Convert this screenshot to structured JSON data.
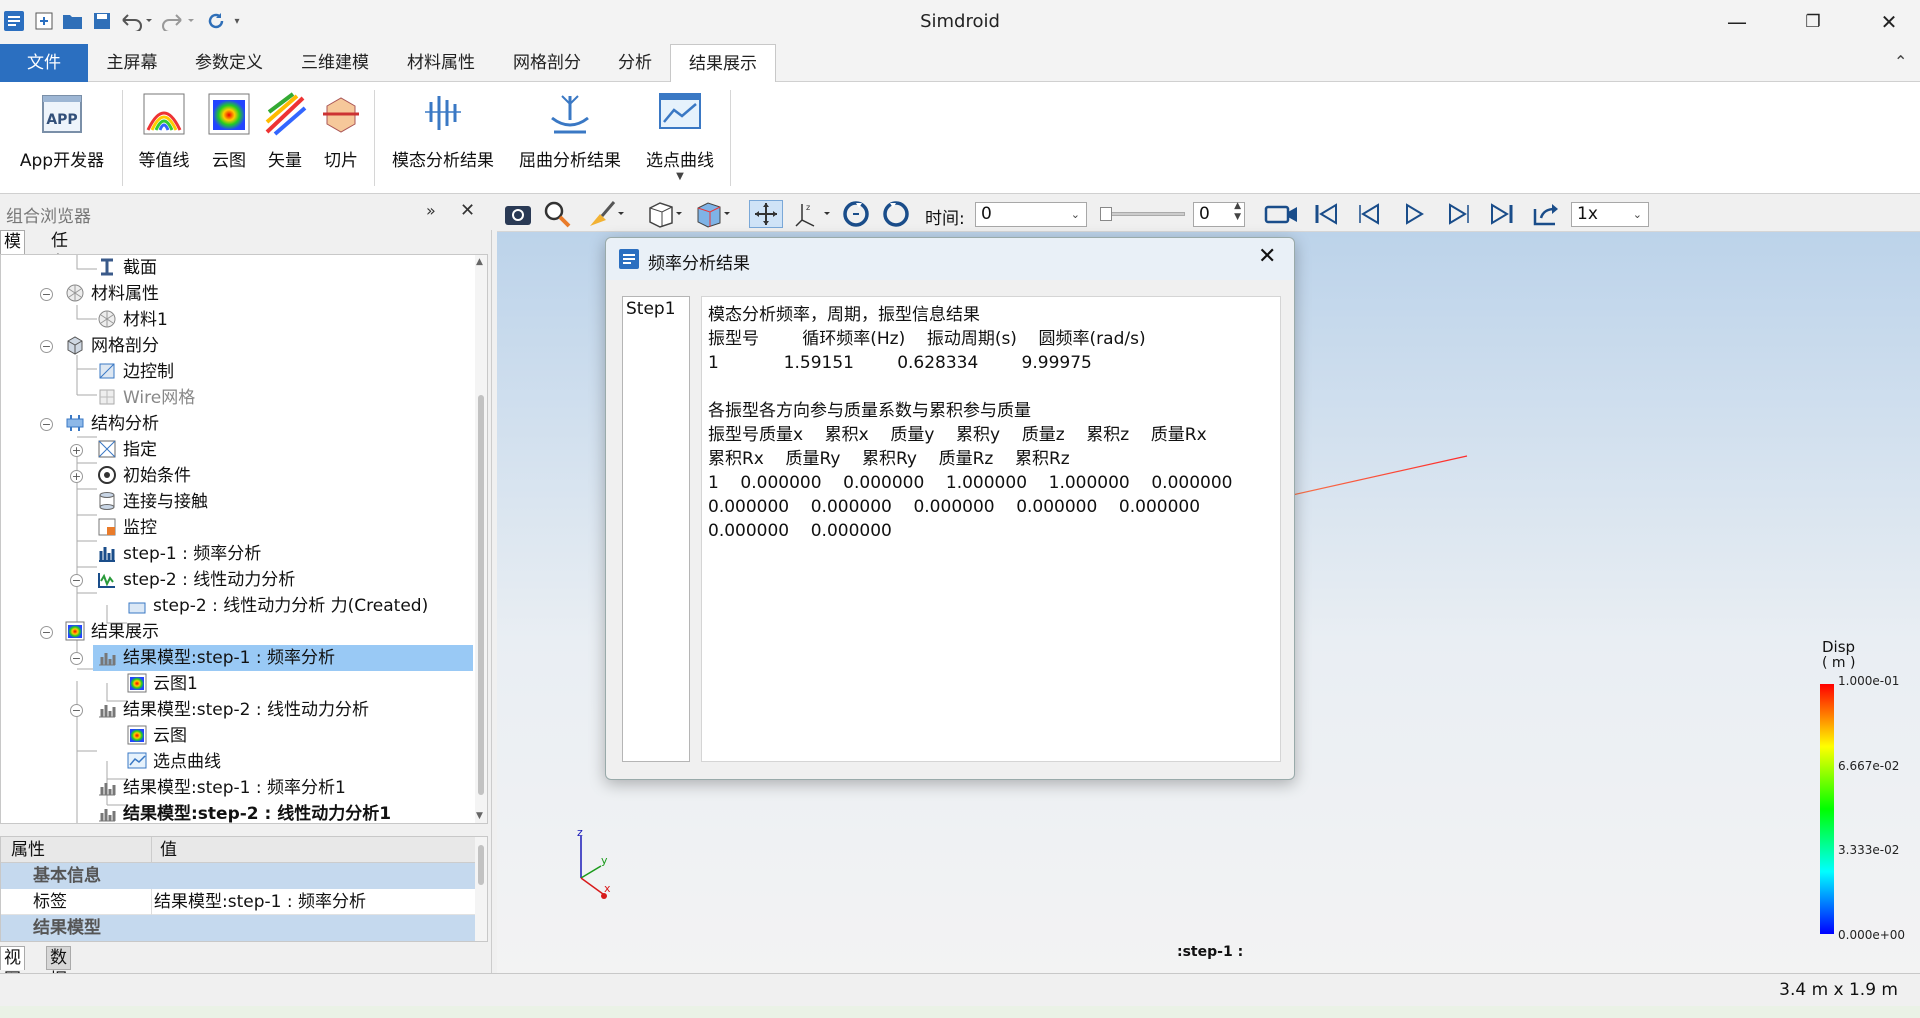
{
  "app": {
    "title": "Simdroid"
  },
  "window_controls": [
    "minimize-icon",
    "restore-icon",
    "close-icon"
  ],
  "ribbon_tabs": [
    "文件",
    "主屏幕",
    "参数定义",
    "三维建模",
    "材料属性",
    "网格剖分",
    "分析",
    "结果展示"
  ],
  "ribbon_active_tab": "结果展示",
  "ribbon_buttons": [
    {
      "label": "App开发器",
      "icon": "app-icon"
    },
    {
      "label": "等值线",
      "icon": "contour-icon"
    },
    {
      "label": "云图",
      "icon": "cloud-map-icon"
    },
    {
      "label": "矢量",
      "icon": "vector-icon"
    },
    {
      "label": "切片",
      "icon": "slice-icon"
    },
    {
      "label": "模态分析结果",
      "icon": "modal-result-icon"
    },
    {
      "label": "屈曲分析结果",
      "icon": "buckling-result-icon"
    },
    {
      "label": "选点曲线",
      "icon": "point-curve-icon"
    }
  ],
  "browser": {
    "title": "组合浏览器",
    "tabs": [
      "模型",
      "任务"
    ],
    "tree": [
      {
        "label": "截面",
        "icon": "section-icon"
      },
      {
        "label": "材料属性",
        "icon": "material-icon"
      },
      {
        "label": "材料1",
        "icon": "material-icon"
      },
      {
        "label": "网格剖分",
        "icon": "mesh-icon"
      },
      {
        "label": "边控制",
        "icon": "edge-control-icon"
      },
      {
        "label": "Wire网格",
        "icon": "wire-mesh-icon"
      },
      {
        "label": "结构分析",
        "icon": "structure-icon"
      },
      {
        "label": "指定",
        "icon": "assign-icon"
      },
      {
        "label": "初始条件",
        "icon": "initial-condition-icon"
      },
      {
        "label": "连接与接触",
        "icon": "contact-icon"
      },
      {
        "label": "监控",
        "icon": "monitor-icon"
      },
      {
        "label": "step-1 : 频率分析",
        "icon": "step-frequency-icon"
      },
      {
        "label": "step-2 : 线性动力分析",
        "icon": "step-dynamic-icon"
      },
      {
        "label": "step-2 : 线性动力分析 力(Created)",
        "icon": "force-icon"
      },
      {
        "label": "结果展示",
        "icon": "results-icon"
      },
      {
        "label": "结果模型:step-1 : 频率分析",
        "icon": "result-model-icon"
      },
      {
        "label": "云图1",
        "icon": "cloud-map-icon"
      },
      {
        "label": "结果模型:step-2 : 线性动力分析",
        "icon": "result-model-icon"
      },
      {
        "label": "云图",
        "icon": "cloud-map-icon"
      },
      {
        "label": "选点曲线",
        "icon": "point-curve-icon"
      },
      {
        "label": "结果模型:step-1 : 频率分析1",
        "icon": "result-model-icon"
      },
      {
        "label": "结果模型:step-2 : 线性动力分析1",
        "icon": "result-model-icon"
      }
    ]
  },
  "properties": {
    "col_property": "属性",
    "col_value": "值",
    "group_basic": "基本信息",
    "label_key": "标签",
    "label_value": "结果模型:step-1 : 频率分析",
    "group_result": "结果模型"
  },
  "bottom_tabs": [
    "视图",
    "数据"
  ],
  "viewport_toolbar": {
    "time_label": "时间:",
    "time_value": "0",
    "spin_value": "0",
    "speed": "1x"
  },
  "dialog": {
    "title": "频率分析结果",
    "list_items": [
      "Step1"
    ],
    "text": "模态分析频率，周期，振型信息结果\n振型号        循环频率(Hz)    振动周期(s)    圆频率(rad/s)\n1            1.59151        0.628334        9.99975\n\n各振型各方向参与质量系数与累积参与质量\n振型号质量x    累积x    质量y    累积y    质量z    累积z    质量Rx\n累积Rx    质量Ry    累积Ry    质量Rz    累积Rz\n1    0.000000    0.000000    1.000000    1.000000    0.000000\n0.000000    0.000000    0.000000    0.000000    0.000000\n0.000000    0.000000"
  },
  "legend": {
    "title": "Disp",
    "unit": "( m )",
    "ticks": [
      "1.000e-01",
      "6.667e-02",
      "3.333e-02",
      "0.000e+00"
    ],
    "colors": {
      "max": "#ff0000",
      "mid": "#00ff00",
      "min": "#0000ff"
    }
  },
  "axes": {
    "x": "x",
    "y": "y",
    "z": "z"
  },
  "viewport_caption": ":step-1 :",
  "status": {
    "size": "3.4 m x 1.9 m"
  },
  "colors": {
    "accent": "#2b6fc0",
    "selection": "#99c9f5"
  }
}
